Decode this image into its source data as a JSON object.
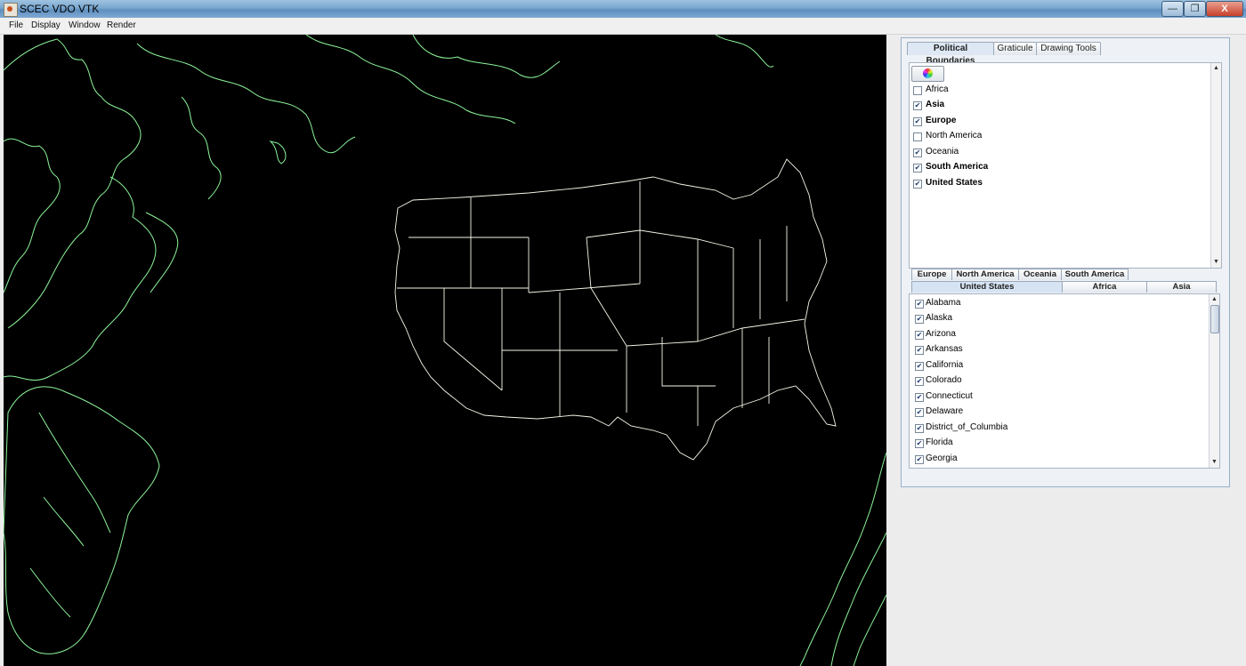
{
  "window": {
    "title": "SCEC VDO VTK",
    "min_glyph": "—",
    "max_glyph": "❐",
    "close_glyph": "X"
  },
  "menu": {
    "file": "File",
    "display": "Display",
    "window": "Window",
    "render": "Render"
  },
  "colors": {
    "map_bg": "#000000",
    "coastline": "#8cf59a",
    "state_border": "#f4f8e8"
  },
  "panel": {
    "tabs": {
      "political": "Political Boundaries",
      "graticule": "Graticule",
      "drawing": "Drawing Tools"
    },
    "regions": [
      {
        "label": "Africa",
        "checked": false,
        "bold": false
      },
      {
        "label": "Asia",
        "checked": true,
        "bold": true
      },
      {
        "label": "Europe",
        "checked": true,
        "bold": true
      },
      {
        "label": "North America",
        "checked": false,
        "bold": false
      },
      {
        "label": "Oceania",
        "checked": true,
        "bold": false
      },
      {
        "label": "South America",
        "checked": true,
        "bold": true
      },
      {
        "label": "United States",
        "checked": true,
        "bold": true
      }
    ],
    "subtabs": {
      "europe": "Europe",
      "north_america": "North America",
      "oceania": "Oceania",
      "south_america": "South America",
      "united_states": "United States",
      "africa": "Africa",
      "asia": "Asia"
    },
    "states": [
      {
        "label": "Alabama",
        "checked": true
      },
      {
        "label": "Alaska",
        "checked": true
      },
      {
        "label": "Arizona",
        "checked": true
      },
      {
        "label": "Arkansas",
        "checked": true
      },
      {
        "label": "California",
        "checked": true
      },
      {
        "label": "Colorado",
        "checked": true
      },
      {
        "label": "Connecticut",
        "checked": true
      },
      {
        "label": "Delaware",
        "checked": true
      },
      {
        "label": "District_of_Columbia",
        "checked": true
      },
      {
        "label": "Florida",
        "checked": true
      },
      {
        "label": "Georgia",
        "checked": true
      }
    ]
  }
}
